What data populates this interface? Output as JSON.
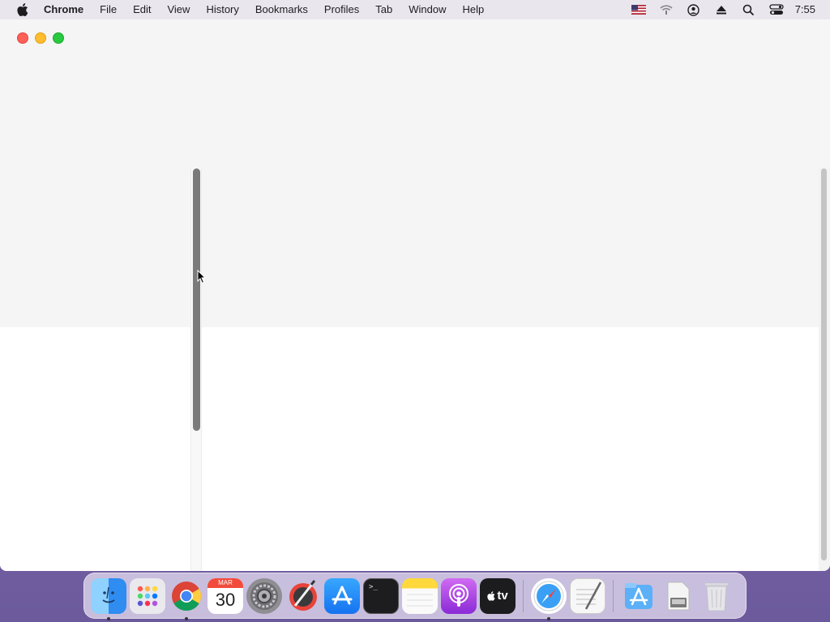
{
  "menubar": {
    "apple_icon": "apple-logo-icon",
    "app_name": "Chrome",
    "items": [
      "File",
      "Edit",
      "View",
      "History",
      "Bookmarks",
      "Profiles",
      "Tab",
      "Window",
      "Help"
    ],
    "status_icons": [
      "us-flag-icon",
      "wifi-icon",
      "user-account-icon",
      "eject-icon",
      "spotlight-search-icon",
      "control-center-icon"
    ],
    "clock": "7:55"
  },
  "window": {
    "title": "",
    "traffic_lights": [
      "close",
      "minimize",
      "maximize"
    ]
  },
  "dock": {
    "apps": [
      {
        "name": "Finder",
        "icon": "finder-icon",
        "running": true
      },
      {
        "name": "Launchpad",
        "icon": "launchpad-icon",
        "running": false
      },
      {
        "name": "Google Chrome",
        "icon": "chrome-icon",
        "running": true
      },
      {
        "name": "Calendar",
        "icon": "calendar-icon",
        "running": false,
        "month": "MAR",
        "day": "30"
      },
      {
        "name": "System Preferences",
        "icon": "gear-icon",
        "running": false
      },
      {
        "name": "Instruments",
        "icon": "instruments-icon",
        "running": false
      },
      {
        "name": "App Store",
        "icon": "app-store-icon",
        "running": false
      },
      {
        "name": "Terminal",
        "icon": "terminal-icon",
        "running": false,
        "prompt": ">_"
      },
      {
        "name": "Notes",
        "icon": "notes-icon",
        "running": false
      },
      {
        "name": "Podcasts",
        "icon": "podcasts-icon",
        "running": false
      },
      {
        "name": "Apple TV",
        "icon": "apple-tv-icon",
        "running": false,
        "label": "tv"
      },
      {
        "name": "Safari",
        "icon": "safari-icon",
        "running": true
      },
      {
        "name": "TextEdit",
        "icon": "textedit-icon",
        "running": false
      },
      {
        "name": "App Store Downloads",
        "icon": "app-store-folder-icon",
        "running": false
      },
      {
        "name": "Disk",
        "icon": "drive-icon",
        "running": false
      },
      {
        "name": "Trash",
        "icon": "trash-icon",
        "running": false
      }
    ]
  },
  "colors": {
    "close": "#ff5f57",
    "minimize": "#febc2e",
    "maximize": "#28c840",
    "pane_thumb": "#7a7a7a"
  }
}
